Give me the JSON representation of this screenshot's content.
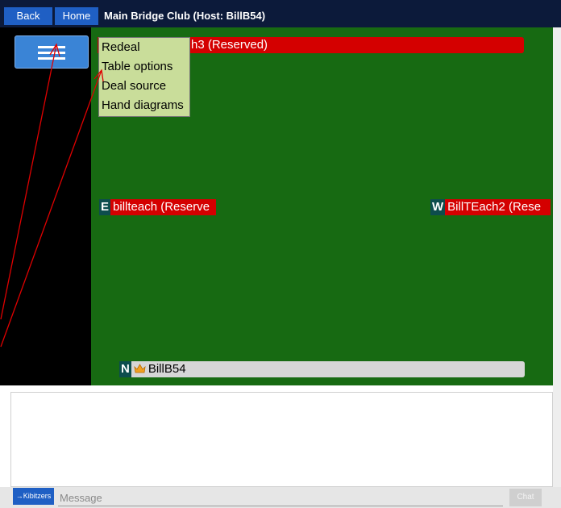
{
  "topbar": {
    "back_label": "Back",
    "home_label": "Home",
    "title": "Main Bridge Club (Host: BillB54)"
  },
  "menu": {
    "icon": "hamburger-menu-icon",
    "items": [
      {
        "label": "Redeal"
      },
      {
        "label": "Table options"
      },
      {
        "label": "Deal source"
      },
      {
        "label": "Hand diagrams"
      }
    ]
  },
  "seats": {
    "south": {
      "letter": "",
      "name": "…h3 (Reserved)",
      "visible_text": "h3 (Reserved)"
    },
    "east": {
      "letter": "E",
      "name": "billteach (Reserve"
    },
    "west": {
      "letter": "W",
      "name": "BillTEach2 (Rese"
    },
    "north": {
      "letter": "N",
      "name": "BillB54",
      "icon": "crown-icon"
    }
  },
  "chat": {
    "kibitzers_label": "→Kibitzers",
    "message_placeholder": "Message",
    "chat_button_label": "Chat"
  },
  "colors": {
    "topbar": "#0c1a3a",
    "button_blue": "#1f5fc4",
    "table_green": "#176a12",
    "reserved_red": "#d40000",
    "menu_bg": "#c9dd9a",
    "seat_letter_bg": "#0d4d4d",
    "annotation_arrow": "#e00000"
  }
}
